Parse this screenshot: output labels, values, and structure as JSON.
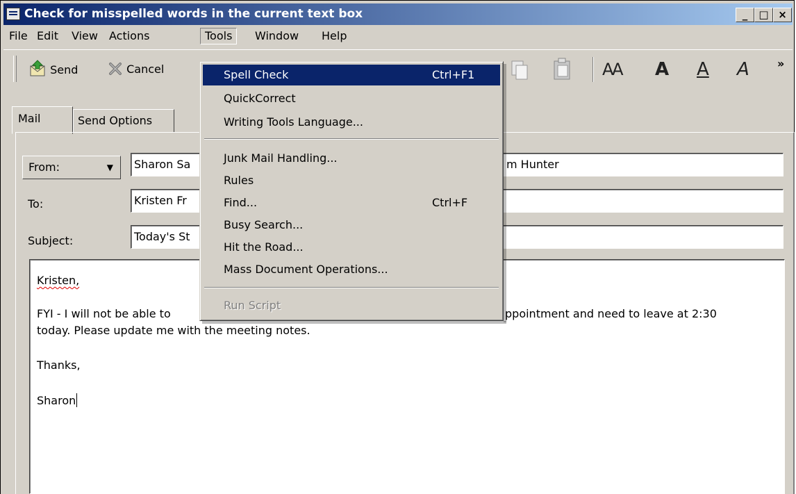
{
  "window": {
    "title": "Check for misspelled words in the current text box",
    "controls": {
      "minimize": "_",
      "maximize": "□",
      "close": "×"
    }
  },
  "menubar": {
    "items": [
      "File",
      "Edit",
      "View",
      "Actions",
      "Tools",
      "Window",
      "Help"
    ],
    "open": "Tools"
  },
  "toolbar": {
    "send_label": "Send",
    "cancel_label": "Cancel",
    "format_glyphs": [
      "AA",
      "A",
      "A",
      "A"
    ],
    "overflow": "»"
  },
  "tabs": [
    "Mail",
    "Send Options"
  ],
  "compose": {
    "from_label": "From:",
    "from_value": "Sharon Sa",
    "from_value_right": "m Hunter",
    "to_label": "To:",
    "to_value": "Kristen Fr",
    "subject_label": "Subject:",
    "subject_value": "Today's St",
    "body": {
      "greeting": "Kristen,",
      "line1_left": "FYI - I will not be able to",
      "line1_right": "ppointment and need to leave at 2:30",
      "line2": "today.  Please update me with the meeting notes.",
      "closing": "Thanks,",
      "signature": "Sharon"
    }
  },
  "tools_menu": {
    "items": [
      {
        "label": "Spell Check",
        "shortcut": "Ctrl+F1",
        "highlighted": true,
        "enabled": true
      },
      {
        "label": "QuickCorrect",
        "shortcut": "",
        "highlighted": false,
        "enabled": true
      },
      {
        "label": "Writing Tools Language...",
        "shortcut": "",
        "highlighted": false,
        "enabled": true
      },
      {
        "label": "Junk Mail Handling...",
        "shortcut": "",
        "highlighted": false,
        "enabled": true
      },
      {
        "label": "Rules",
        "shortcut": "",
        "highlighted": false,
        "enabled": true
      },
      {
        "label": "Find...",
        "shortcut": "Ctrl+F",
        "highlighted": false,
        "enabled": true
      },
      {
        "label": "Busy Search...",
        "shortcut": "",
        "highlighted": false,
        "enabled": true
      },
      {
        "label": "Hit the Road...",
        "shortcut": "",
        "highlighted": false,
        "enabled": true
      },
      {
        "label": "Mass Document Operations...",
        "shortcut": "",
        "highlighted": false,
        "enabled": true
      },
      {
        "label": "Run Script",
        "shortcut": "",
        "highlighted": false,
        "enabled": false
      }
    ]
  },
  "colors": {
    "title_start": "#0a246a",
    "title_end": "#a6caf0",
    "highlight": "#0a246a",
    "face": "#d4d0c8"
  }
}
